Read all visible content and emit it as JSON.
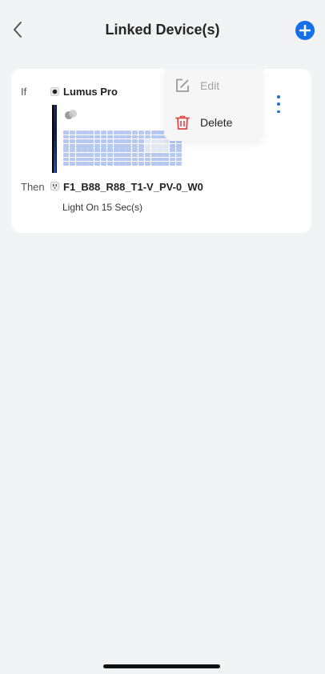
{
  "header": {
    "title": "Linked Device(s)",
    "back_icon": "chevron-left-icon",
    "add_icon": "plus-circle-icon",
    "accent": "#1670e8"
  },
  "rule": {
    "if_label": "If",
    "trigger_device": "Lumus Pro",
    "then_label": "Then",
    "target_device": "F1_B88_R88_T1-V_PV-0_W0",
    "action": "Light On 15 Sec(s)"
  },
  "menu": {
    "edit_label": "Edit",
    "delete_label": "Delete",
    "delete_color": "#e04848"
  }
}
